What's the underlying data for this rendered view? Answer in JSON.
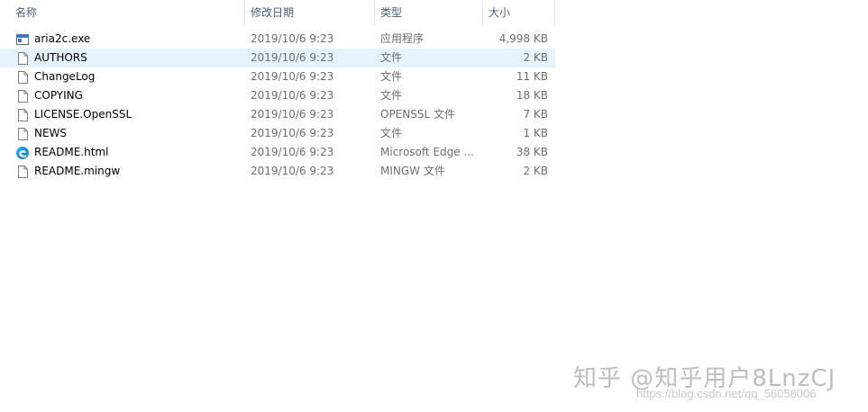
{
  "header": {
    "name": "名称",
    "date": "修改日期",
    "type": "类型",
    "size": "大小",
    "sort_arrow": "^"
  },
  "files": [
    {
      "name": "aria2c.exe",
      "date": "2019/10/6 9:23",
      "type": "应用程序",
      "size": "4,998 KB",
      "icon": "exe-icon"
    },
    {
      "name": "AUTHORS",
      "date": "2019/10/6 9:23",
      "type": "文件",
      "size": "2 KB",
      "icon": "file-icon"
    },
    {
      "name": "ChangeLog",
      "date": "2019/10/6 9:23",
      "type": "文件",
      "size": "11 KB",
      "icon": "file-icon"
    },
    {
      "name": "COPYING",
      "date": "2019/10/6 9:23",
      "type": "文件",
      "size": "18 KB",
      "icon": "file-icon"
    },
    {
      "name": "LICENSE.OpenSSL",
      "date": "2019/10/6 9:23",
      "type": "OPENSSL 文件",
      "size": "7 KB",
      "icon": "file-icon"
    },
    {
      "name": "NEWS",
      "date": "2019/10/6 9:23",
      "type": "文件",
      "size": "1 KB",
      "icon": "file-icon"
    },
    {
      "name": "README.html",
      "date": "2019/10/6 9:23",
      "type": "Microsoft Edge ...",
      "size": "38 KB",
      "icon": "edge-icon"
    },
    {
      "name": "README.mingw",
      "date": "2019/10/6 9:23",
      "type": "MINGW 文件",
      "size": "2 KB",
      "icon": "file-icon"
    }
  ],
  "watermark": {
    "text": "知乎 @知乎用户8LnzCJ",
    "url": "https://blog.csdn.net/qq_56058006"
  },
  "colors": {
    "selected_row": "#e5f3ff",
    "header_text": "#4c607a"
  }
}
